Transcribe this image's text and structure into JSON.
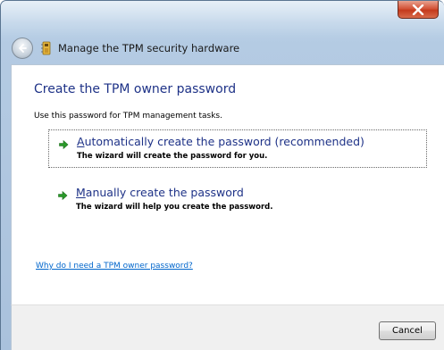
{
  "window": {
    "title": "Manage the TPM security hardware",
    "close_icon": "close-x-icon",
    "back_icon": "back-arrow-icon",
    "app_icon": "tpm-chip-icon"
  },
  "page": {
    "heading": "Create the TPM owner password",
    "description": "Use this password for TPM management tasks."
  },
  "options": [
    {
      "accelerator": "A",
      "title_rest": "utomatically create the password (recommended)",
      "subtitle": "The wizard will create the password for you.",
      "icon": "green-arrow-icon"
    },
    {
      "accelerator": "M",
      "title_rest": "anually create the password",
      "subtitle": "The wizard will help you create the password.",
      "icon": "green-arrow-icon"
    }
  ],
  "help_link": "Why do I need a TPM owner password?",
  "footer": {
    "cancel_label": "Cancel"
  },
  "colors": {
    "heading": "#1e3287",
    "link": "#0066cc",
    "arrow": "#2a9a2a",
    "close_button": "#c43a1c"
  }
}
